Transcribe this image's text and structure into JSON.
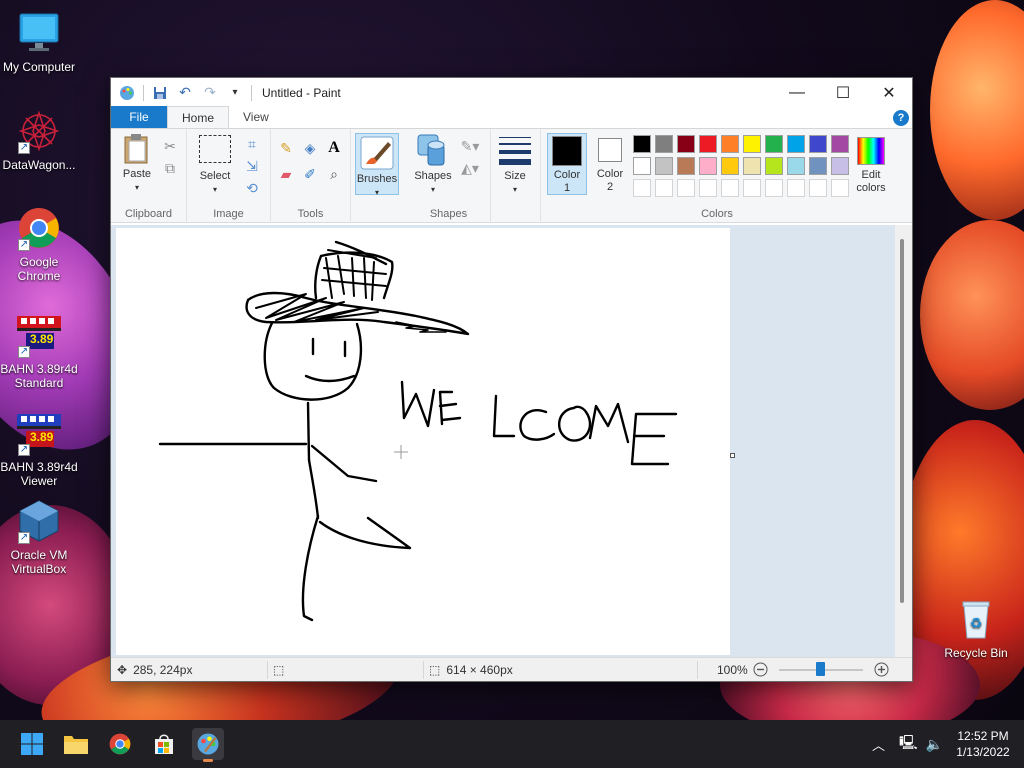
{
  "desktop": {
    "icons": [
      {
        "label": "My Computer"
      },
      {
        "label": "DataWagon..."
      },
      {
        "label": "Google Chrome"
      },
      {
        "label": "BAHN 3.89r4d Standard",
        "badge": "3.89"
      },
      {
        "label": "BAHN 3.89r4d Viewer",
        "badge": "3.89"
      },
      {
        "label": "Oracle VM VirtualBox"
      },
      {
        "label": "Recycle Bin"
      }
    ]
  },
  "paint": {
    "title": "Untitled - Paint",
    "tabs": {
      "file": "File",
      "home": "Home",
      "view": "View"
    },
    "ribbon": {
      "clipboard": {
        "paste": "Paste",
        "group": "Clipboard"
      },
      "image": {
        "select": "Select",
        "group": "Image"
      },
      "tools": {
        "group": "Tools"
      },
      "brushes": {
        "label": "Brushes"
      },
      "shapes": {
        "label": "Shapes",
        "group": "Shapes"
      },
      "size": {
        "label": "Size"
      },
      "color1": {
        "label1": "Color",
        "label2": "1"
      },
      "color2": {
        "label1": "Color",
        "label2": "2"
      },
      "colors": {
        "group": "Colors",
        "edit1": "Edit",
        "edit2": "colors"
      },
      "palette_row1": [
        "#000000",
        "#7f7f7f",
        "#880015",
        "#ed1c24",
        "#ff7f27",
        "#fff200",
        "#22b14c",
        "#00a2e8",
        "#3f48cc",
        "#a349a4"
      ],
      "palette_row2": [
        "#ffffff",
        "#c3c3c3",
        "#b97a57",
        "#ffaec9",
        "#ffc90e",
        "#efe4b0",
        "#b5e61d",
        "#99d9ea",
        "#7092be",
        "#c8bfe7"
      ]
    },
    "canvas": {
      "text": "WELCOME"
    },
    "status": {
      "cursor": "285, 224px",
      "size": "614 × 460px",
      "zoom": "100%"
    }
  },
  "taskbar": {
    "time": "12:52 PM",
    "date": "1/13/2022"
  }
}
